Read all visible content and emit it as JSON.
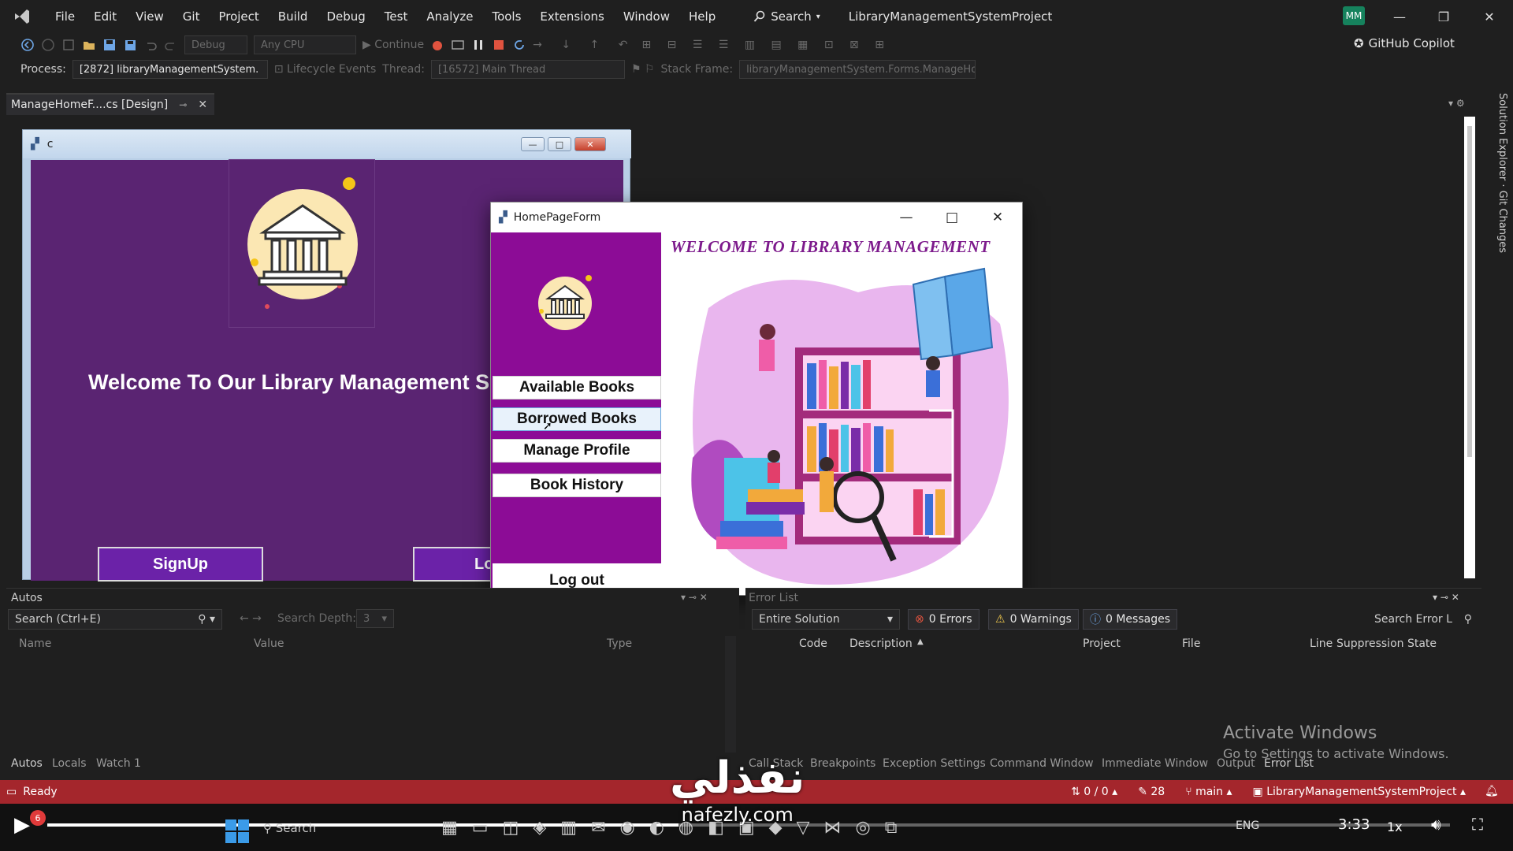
{
  "menubar": {
    "items": [
      "File",
      "Edit",
      "View",
      "Git",
      "Project",
      "Build",
      "Debug",
      "Test",
      "Analyze",
      "Tools",
      "Extensions",
      "Window",
      "Help"
    ],
    "search_label": "Search",
    "solution_title": "LibraryManagementSystemProject",
    "user_initials": "MM"
  },
  "toolbar": {
    "config": "Debug",
    "platform": "Any CPU",
    "continue_label": "Continue",
    "copilot_label": "GitHub Copilot"
  },
  "procbar": {
    "process_label": "Process:",
    "process_value": "[2872] libraryManagementSystem.",
    "lifecycle_label": "Lifecycle Events",
    "thread_label": "Thread:",
    "thread_value": "[16572] Main Thread",
    "stackframe_label": "Stack Frame:",
    "stackframe_value": "libraryManagementSystem.Forms.ManageHom"
  },
  "doc_tab": {
    "label": "ManageHomeF....cs [Design]"
  },
  "designer_form": {
    "title": "c",
    "welcome": "Welcome To Our Library Management S",
    "signup_label": "SignUp",
    "login_label": "Lo"
  },
  "homepage_form": {
    "title": "HomePageForm",
    "banner": "WELCOME TO LIBRARY MANAGEMENT",
    "nav": [
      {
        "label": "Available Books"
      },
      {
        "label": "Borrowed Books"
      },
      {
        "label": "Manage Profile"
      },
      {
        "label": "Book History"
      }
    ],
    "logout_label": "Log out"
  },
  "autos": {
    "title": "Autos",
    "search_placeholder": "Search (Ctrl+E)",
    "search_depth_label": "Search Depth:",
    "search_depth_value": "3",
    "columns": [
      "Name",
      "Value",
      "Type"
    ],
    "tabs": [
      "Autos",
      "Locals",
      "Watch 1"
    ]
  },
  "errlist": {
    "title": "Error List",
    "scope": "Entire Solution",
    "errors": "0 Errors",
    "warnings": "0 Warnings",
    "messages": "0 Messages",
    "search_placeholder": "Search Error L",
    "columns": [
      "Code",
      "Description",
      "Project",
      "File",
      "Line",
      "Suppression State"
    ],
    "tabs": [
      "Call Stack",
      "Breakpoints",
      "Exception Settings",
      "Command Window",
      "Immediate Window",
      "Output",
      "Error List"
    ]
  },
  "status": {
    "ready": "Ready",
    "sync": "0 / 0",
    "edits": "28",
    "branch": "main",
    "repo": "LibraryManagementSystemProject"
  },
  "activate": {
    "title": "Activate Windows",
    "subtitle": "Go to Settings to activate Windows."
  },
  "watermark": {
    "arabic": "نفذلي",
    "url": "nafezly.com"
  },
  "player": {
    "time": "3:33",
    "speed": "1x",
    "notif": "6",
    "lang": "ENG",
    "taskbar_search": "Search",
    "progress": 0.45
  },
  "colors": {
    "accent_purple": "#8c0c96",
    "status_red": "#a4262c",
    "designer_purple": "#5a2472"
  }
}
